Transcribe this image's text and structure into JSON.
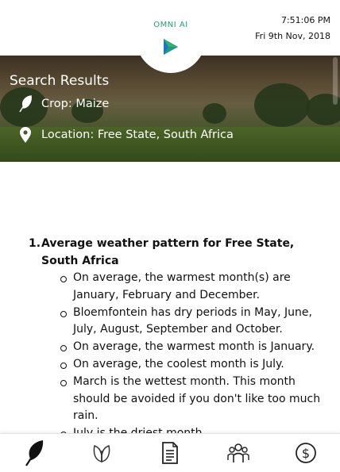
{
  "header": {
    "logo_text": "OMNI AI",
    "time": "7:51:06 PM",
    "date": "Fri 9th Nov, 2018"
  },
  "hero": {
    "title": "Search Results",
    "crop": "Crop: Maize",
    "location": "Location: Free State, South Africa"
  },
  "results": [
    {
      "number": "1.",
      "title": "Average weather pattern for Free State, South Africa",
      "bullets": [
        "On average, the warmest month(s) are January, February and December.",
        "Bloemfontein has dry periods in May, June, July, August, September and October.",
        "On average, the warmest month is January.",
        "On average, the coolest month is July.",
        "March is the wettest month. This month should be avoided if you don't like too much rain.",
        "July is the driest month."
      ]
    }
  ],
  "nav": {
    "items": [
      "feather-icon",
      "leaf-icon",
      "document-icon",
      "team-icon",
      "dollar-icon"
    ]
  },
  "colors": {
    "logo_green": "#20a070",
    "logo_blue": "#1a76c9"
  }
}
